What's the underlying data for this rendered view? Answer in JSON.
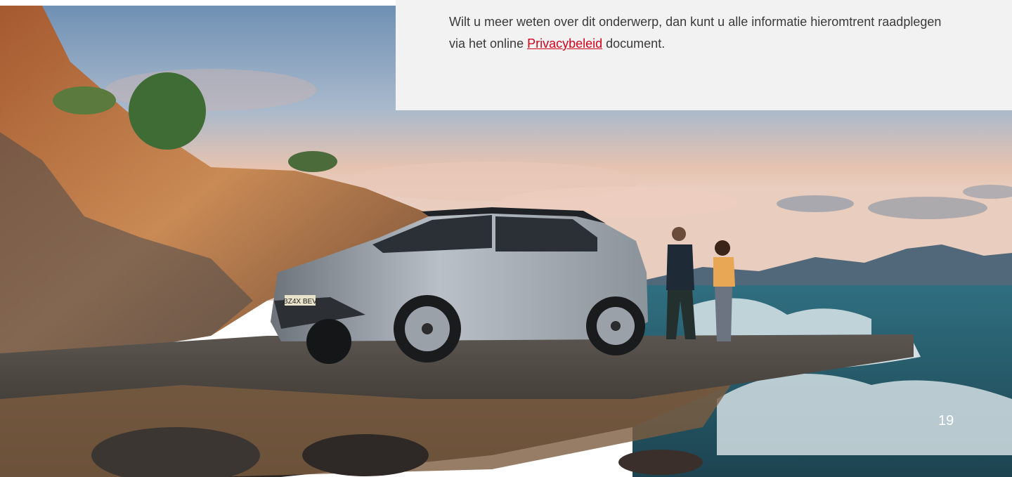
{
  "info_box": {
    "text_before": "Wilt u meer weten over dit onderwerp, dan kunt u alle informatie hieromtrent raadplegen via het online ",
    "link_label": "Privacybeleid",
    "text_after": " document.",
    "link_color": "#d4001a",
    "background": "#f2f2f2"
  },
  "photo": {
    "license_plate": "BZ4X BEV"
  },
  "page_number": "19"
}
